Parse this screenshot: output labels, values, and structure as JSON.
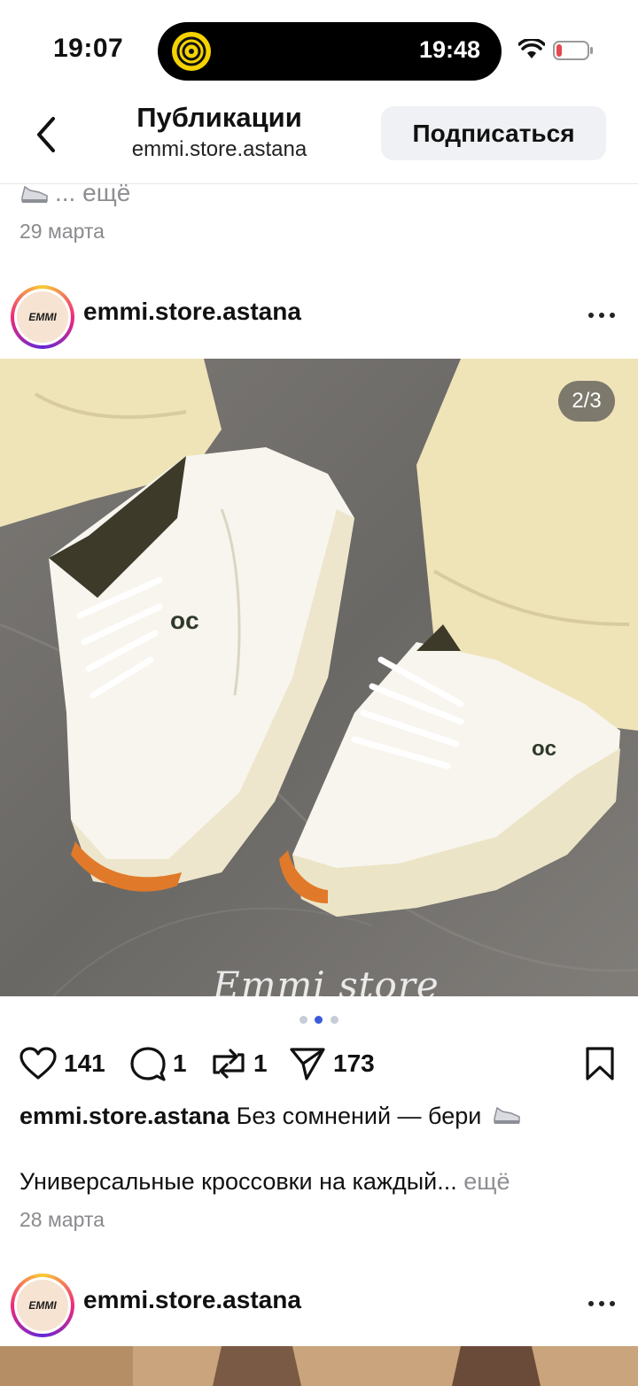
{
  "status_bar": {
    "time": "19:07",
    "island_time": "19:48",
    "battery_low_color": "#e5484d"
  },
  "nav": {
    "title": "Публикации",
    "subtitle": "emmi.store.astana",
    "subscribe_label": "Подписаться"
  },
  "prev_post": {
    "more_label": "... ещё",
    "date": "29 марта"
  },
  "post": {
    "avatar_text": "EMMI",
    "username": "emmi.store.astana",
    "counter": "2/3",
    "watermark": "Emmi store",
    "carousel": {
      "total": 3,
      "active": 2
    },
    "likes": "141",
    "comments": "1",
    "reposts": "1",
    "shares": "173",
    "caption_user": "emmi.store.astana",
    "caption_text": "Без сомнений — бери",
    "caption_line2": "Универсальные кроссовки на каждый...",
    "caption_more": "ещё",
    "date": "28 марта"
  },
  "next_post": {
    "avatar_text": "EMMI",
    "username": "emmi.store.astana"
  },
  "colors": {
    "accent_dot": "#3b5bdb",
    "secondary_text": "#8a8a8e",
    "button_bg": "#eff1f4"
  }
}
